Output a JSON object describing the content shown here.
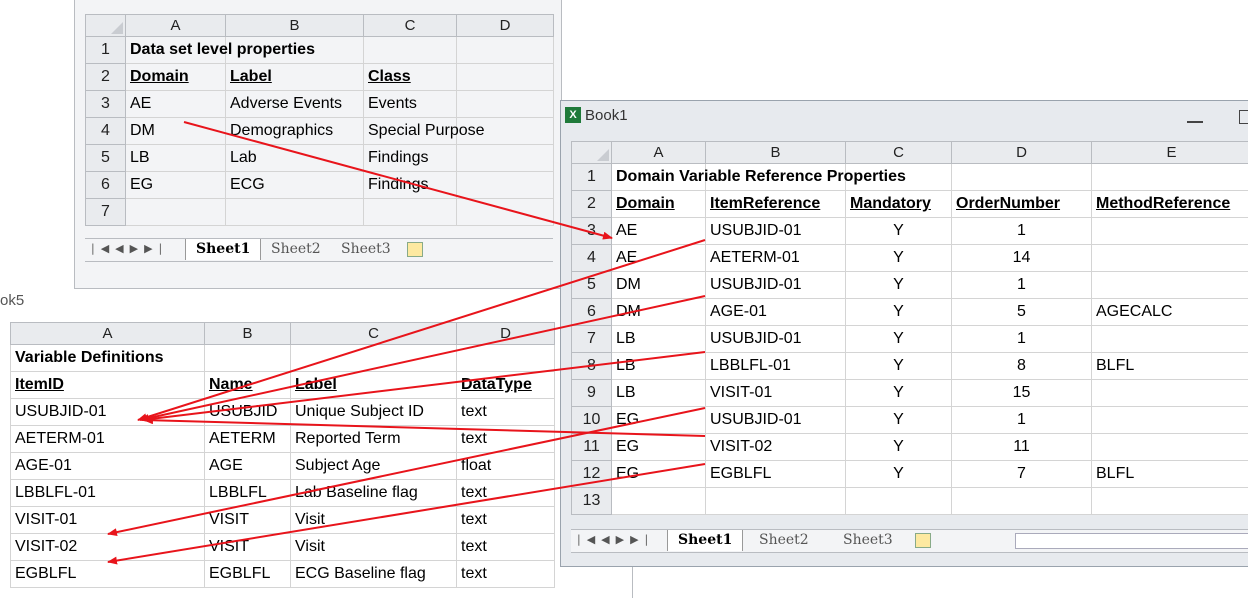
{
  "book1_title": "Book1",
  "book5_label": "ok5",
  "top": {
    "cols": [
      "A",
      "B",
      "C",
      "D"
    ],
    "rows": [
      {
        "n": "1",
        "a": "Data set level properties",
        "b": "",
        "c": "",
        "d": ""
      },
      {
        "n": "2",
        "a": "Domain",
        "b": "Label",
        "c": "Class",
        "d": ""
      },
      {
        "n": "3",
        "a": "AE",
        "b": "Adverse Events",
        "c": "Events",
        "d": ""
      },
      {
        "n": "4",
        "a": "DM",
        "b": "Demographics",
        "c": "Special Purpose",
        "d": ""
      },
      {
        "n": "5",
        "a": "LB",
        "b": "Lab",
        "c": "Findings",
        "d": ""
      },
      {
        "n": "6",
        "a": "EG",
        "b": "ECG",
        "c": "Findings",
        "d": ""
      },
      {
        "n": "7",
        "a": "",
        "b": "",
        "c": "",
        "d": ""
      }
    ],
    "tabs": [
      "Sheet1",
      "Sheet2",
      "Sheet3"
    ]
  },
  "right": {
    "cols": [
      "A",
      "B",
      "C",
      "D",
      "E"
    ],
    "rows": [
      {
        "n": "1",
        "a": "Domain Variable Reference Properties",
        "b": "",
        "c": "",
        "d": "",
        "e": ""
      },
      {
        "n": "2",
        "a": "Domain",
        "b": "ItemReference",
        "c": "Mandatory",
        "d": "OrderNumber",
        "e": "MethodReference"
      },
      {
        "n": "3",
        "a": "AE",
        "b": "USUBJID-01",
        "c": "Y",
        "d": "1",
        "e": ""
      },
      {
        "n": "4",
        "a": "AE",
        "b": "AETERM-01",
        "c": "Y",
        "d": "14",
        "e": ""
      },
      {
        "n": "5",
        "a": "DM",
        "b": "USUBJID-01",
        "c": "Y",
        "d": "1",
        "e": ""
      },
      {
        "n": "6",
        "a": "DM",
        "b": "AGE-01",
        "c": "Y",
        "d": "5",
        "e": "AGECALC"
      },
      {
        "n": "7",
        "a": "LB",
        "b": "USUBJID-01",
        "c": "Y",
        "d": "1",
        "e": ""
      },
      {
        "n": "8",
        "a": "LB",
        "b": "LBBLFL-01",
        "c": "Y",
        "d": "8",
        "e": "BLFL"
      },
      {
        "n": "9",
        "a": "LB",
        "b": "VISIT-01",
        "c": "Y",
        "d": "15",
        "e": ""
      },
      {
        "n": "10",
        "a": "EG",
        "b": "USUBJID-01",
        "c": "Y",
        "d": "1",
        "e": ""
      },
      {
        "n": "11",
        "a": "EG",
        "b": "VISIT-02",
        "c": "Y",
        "d": "11",
        "e": ""
      },
      {
        "n": "12",
        "a": "EG",
        "b": "EGBLFL",
        "c": "Y",
        "d": "7",
        "e": "BLFL"
      },
      {
        "n": "13",
        "a": "",
        "b": "",
        "c": "",
        "d": "",
        "e": ""
      }
    ],
    "tabs": [
      "Sheet1",
      "Sheet2",
      "Sheet3"
    ]
  },
  "left": {
    "cols": [
      "A",
      "B",
      "C",
      "D"
    ],
    "rows": [
      {
        "a": "Variable Definitions",
        "b": "",
        "c": "",
        "d": ""
      },
      {
        "a": "ItemID",
        "b": "Name",
        "c": "Label",
        "d": "DataType"
      },
      {
        "a": "USUBJID-01",
        "b": "USUBJID",
        "c": "Unique Subject ID",
        "d": "text"
      },
      {
        "a": "AETERM-01",
        "b": "AETERM",
        "c": "Reported Term",
        "d": "text"
      },
      {
        "a": "AGE-01",
        "b": "AGE",
        "c": "Subject Age",
        "d": "float"
      },
      {
        "a": "LBBLFL-01",
        "b": "LBBLFL",
        "c": "Lab Baseline flag",
        "d": "text"
      },
      {
        "a": "VISIT-01",
        "b": "VISIT",
        "c": "Visit",
        "d": "text"
      },
      {
        "a": "VISIT-02",
        "b": "VISIT",
        "c": "Visit",
        "d": "text"
      },
      {
        "a": "EGBLFL",
        "b": "EGBLFL",
        "c": "ECG Baseline flag",
        "d": "text"
      }
    ]
  },
  "colors": {
    "arrow": "#e8141b",
    "header": "#e9ebee",
    "grid": "#d4d4d4"
  }
}
